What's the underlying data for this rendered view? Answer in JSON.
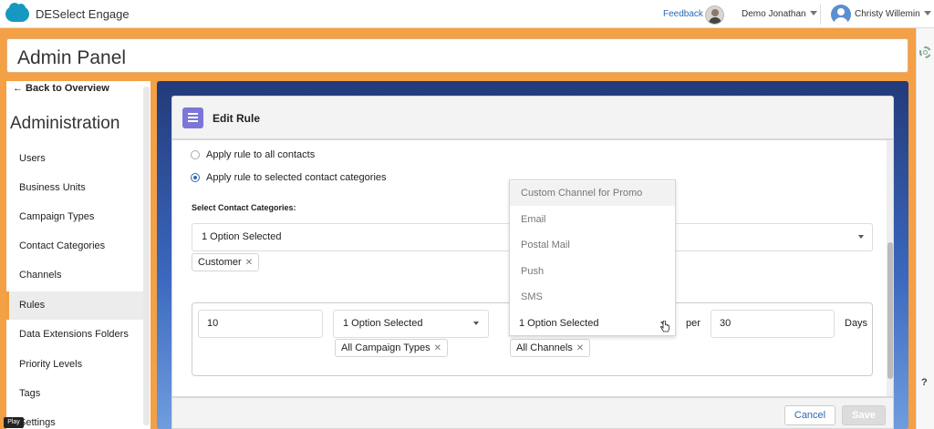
{
  "topbar": {
    "app_name": "DESelect Engage",
    "feedback": "Feedback",
    "business_unit": "Demo Jonathan",
    "user_name": "Christy Willemin"
  },
  "colors": {
    "accent_orange": "#f4a044",
    "primary_blue": "#2a6ab0",
    "icon_purple": "#7b76d8"
  },
  "admin": {
    "title": "Admin Panel"
  },
  "sidebar": {
    "back": "← Back to Overview",
    "title": "Administration",
    "items": [
      {
        "label": "Users"
      },
      {
        "label": "Business Units"
      },
      {
        "label": "Campaign Types"
      },
      {
        "label": "Contact Categories"
      },
      {
        "label": "Channels"
      },
      {
        "label": "Rules",
        "active": true
      },
      {
        "label": "Data Extensions Folders"
      },
      {
        "label": "Priority Levels"
      },
      {
        "label": "Tags"
      },
      {
        "label": "Settings"
      }
    ]
  },
  "edit_rule": {
    "title": "Edit Rule",
    "radio_all": "Apply rule to all contacts",
    "radio_selected": "Apply rule to selected contact categories",
    "select_categories_label": "Select Contact Categories:",
    "categories_select_value": "1 Option Selected",
    "category_chip": "Customer",
    "rule": {
      "count_value": "10",
      "campaign_select_value": "1 Option Selected",
      "campaign_chip": "All Campaign Types",
      "channel_select_value": "1 Option Selected",
      "channel_chip": "All Channels",
      "per_label": "per",
      "days_value": "30",
      "days_label": "Days"
    },
    "channel_options": [
      "Custom Channel for Promo",
      "Email",
      "Postal Mail",
      "Push",
      "SMS"
    ],
    "cancel": "Cancel",
    "save": "Save"
  },
  "video": {
    "play": "Play"
  },
  "help": "?"
}
